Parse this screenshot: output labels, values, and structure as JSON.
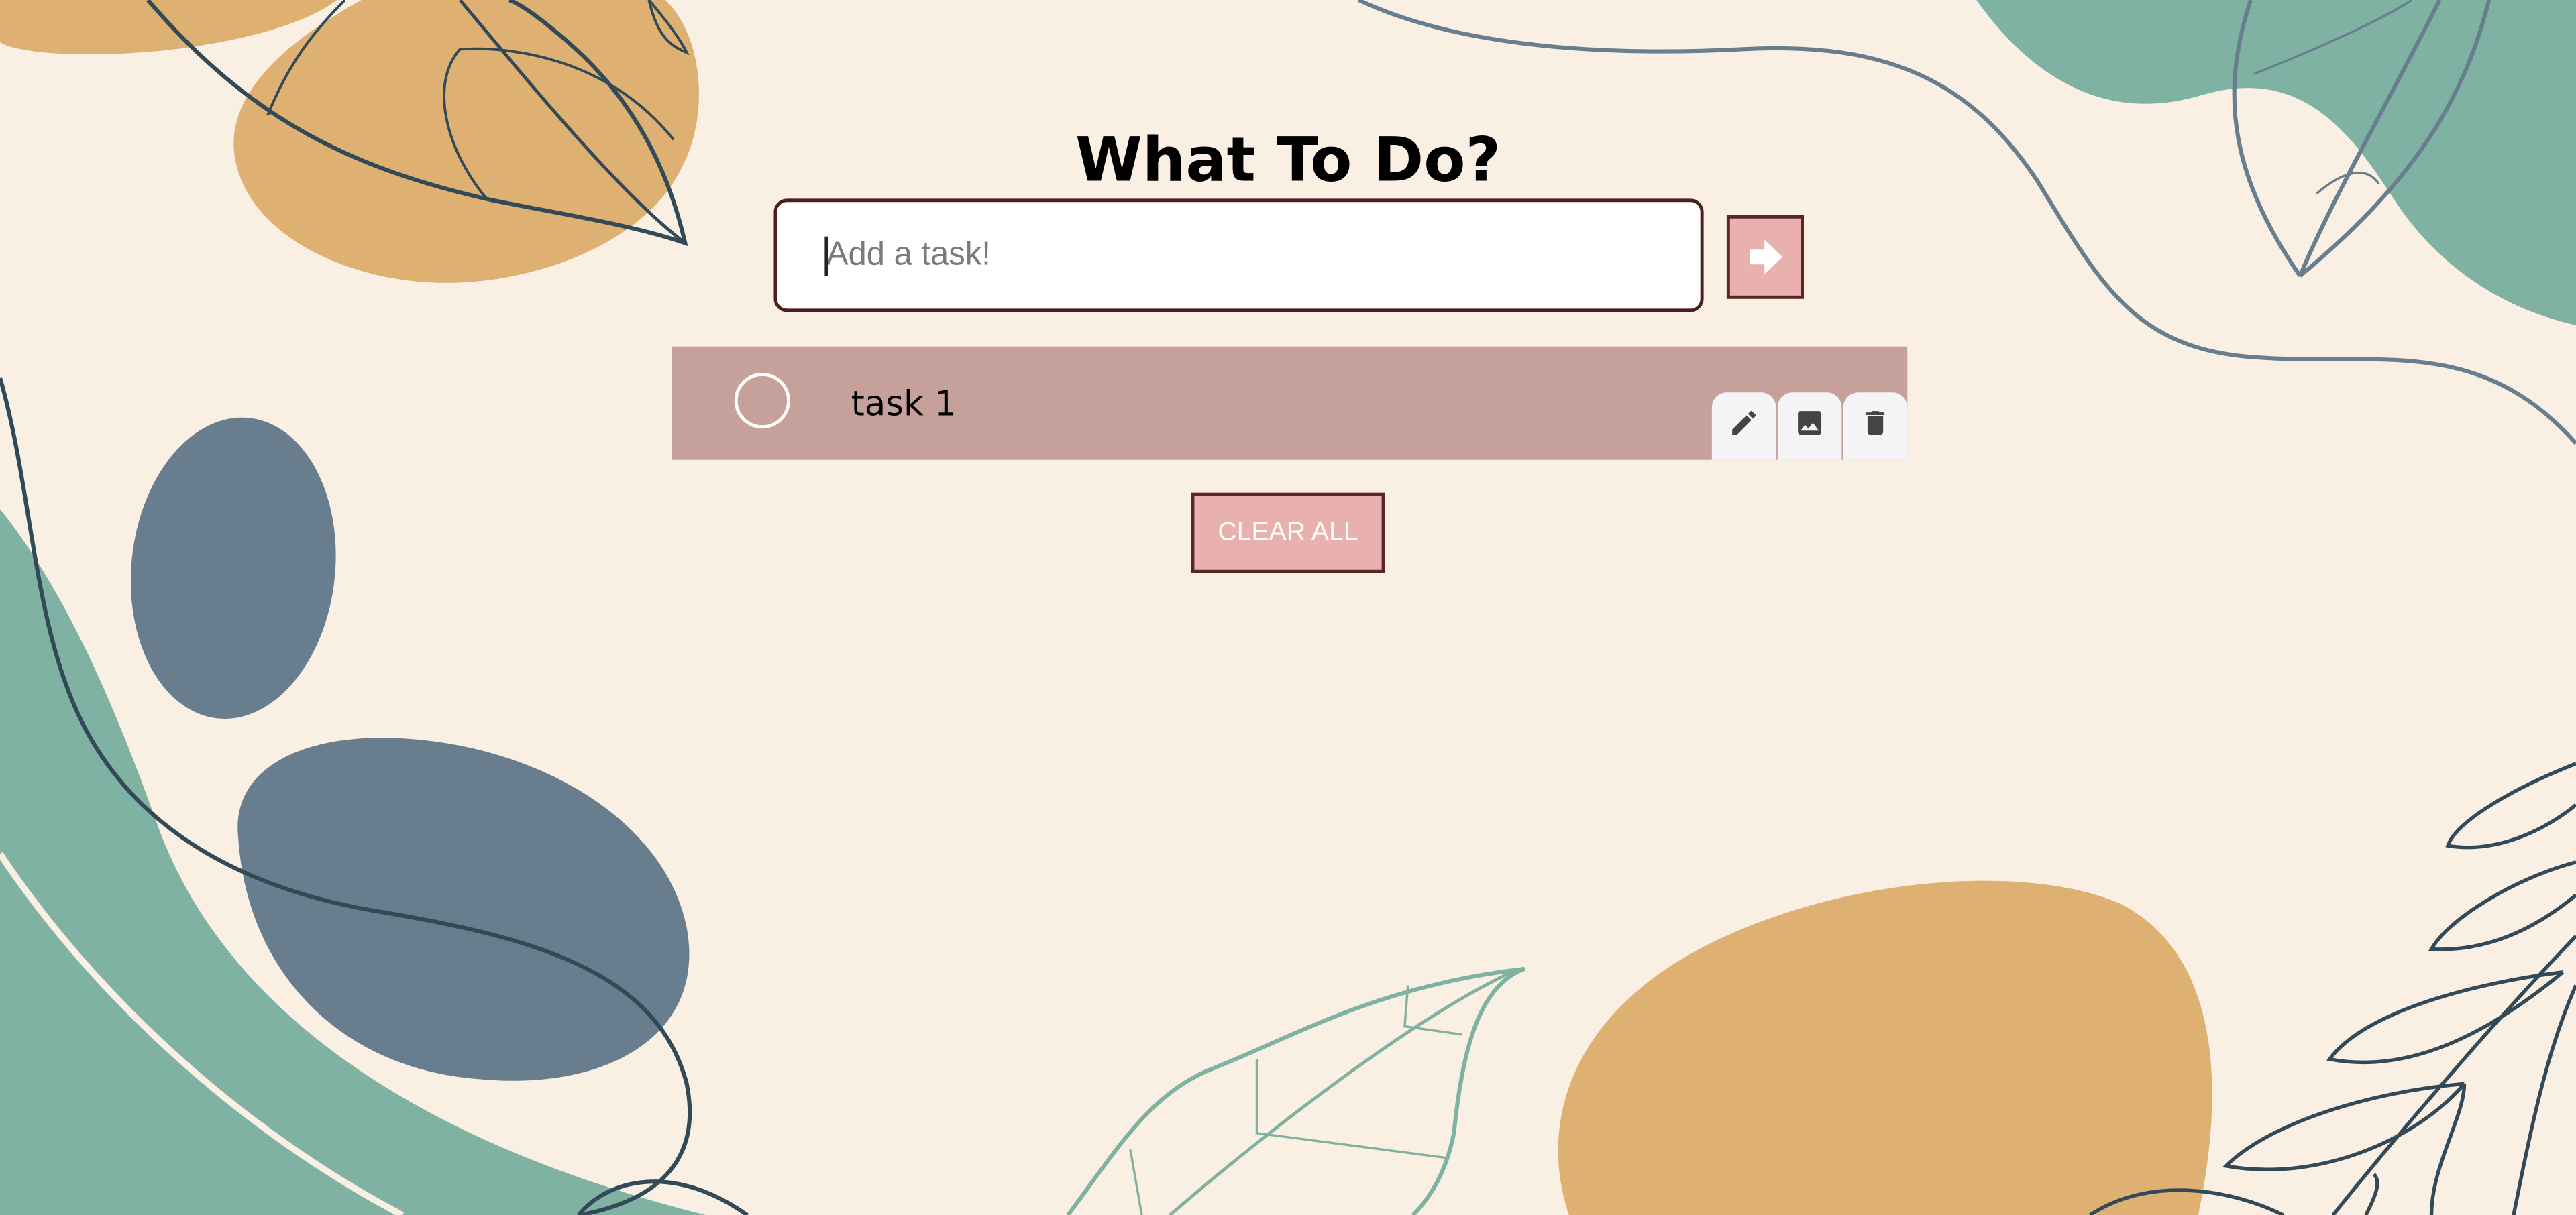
{
  "header": {
    "title": "What To Do?"
  },
  "task_form": {
    "input_value": "",
    "input_placeholder": "Add a task!",
    "submit_icon": "arrow-right-icon"
  },
  "tasks": [
    {
      "text": "task 1",
      "completed": false,
      "actions": [
        "pencil-icon",
        "image-icon",
        "trash-icon"
      ]
    }
  ],
  "controls": {
    "clear_all_label": "CLEAR ALL"
  },
  "colors": {
    "background": "#faefe3",
    "accent_pink": "#e8b1ae",
    "task_row": "#c6a19c",
    "border_dark": "#5a2527",
    "teal": "#80b2a3",
    "slate": "#687e8f",
    "mustard": "#deb071",
    "line": "#324a57"
  }
}
